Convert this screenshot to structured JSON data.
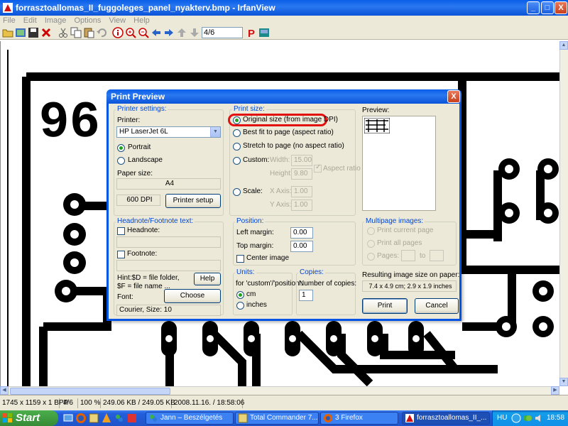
{
  "window": {
    "title": "forrasztoallomas_II_fuggoleges_panel_nyakterv.bmp - IrfanView",
    "minimize": "_",
    "maximize": "□",
    "close": "X"
  },
  "menu": [
    "File",
    "Edit",
    "Image",
    "Options",
    "View",
    "Help"
  ],
  "toolbar": {
    "page_counter": "4/6",
    "icons": [
      "open-folder",
      "thumbnails",
      "save",
      "delete",
      "cut",
      "copy",
      "paste",
      "undo",
      "info",
      "zoom-in",
      "zoom-out",
      "prev",
      "next",
      "first",
      "last",
      "page-field",
      "print-p",
      "paint"
    ]
  },
  "pcb_text": "96",
  "dialog": {
    "title": "Print Preview",
    "close": "X",
    "printer_settings": {
      "group": "Printer settings:",
      "printer_label": "Printer:",
      "printer_value": "HP LaserJet 6L",
      "portrait": "Portrait",
      "landscape": "Landscape",
      "paper_label": "Paper size:",
      "paper_value": "A4",
      "dpi": "600 DPI",
      "setup_button": "Printer setup"
    },
    "print_size": {
      "group": "Print size:",
      "original": "Original size (from image DPI)",
      "best_fit": "Best fit to page (aspect ratio)",
      "stretch": "Stretch to page (no aspect ratio)",
      "custom": "Custom:",
      "width_label": "Width:",
      "width_value": "15.00",
      "height_label": "Height:",
      "height_value": "9.80",
      "aspect": "Aspect ratio",
      "scale": "Scale:",
      "x_label": "X Axis:",
      "x_value": "1.00",
      "y_label": "Y Axis:",
      "y_value": "1.00"
    },
    "preview_label": "Preview:",
    "header_footer": {
      "group": "Headnote/Footnote text:",
      "headnote": "Headnote:",
      "footnote": "Footnote:",
      "hint1": "Hint:$D = file folder,",
      "hint2": "$F = file name ...",
      "help_button": "Help",
      "font_label": "Font:",
      "choose_button": "Choose",
      "font_value": "Courier, Size: 10"
    },
    "position": {
      "group": "Position:",
      "left_label": "Left margin:",
      "left_value": "0.00",
      "top_label": "Top margin:",
      "top_value": "0.00",
      "center": "Center image"
    },
    "units": {
      "group": "Units:",
      "hint": "for 'custom'/'position':",
      "cm": "cm",
      "inches": "inches"
    },
    "copies": {
      "group": "Copies:",
      "label": "Number of copies:",
      "value": "1"
    },
    "multipage": {
      "group": "Multipage images:",
      "current": "Print current page",
      "all": "Print all pages",
      "pages": "Pages:",
      "to": "to"
    },
    "result": {
      "label": "Resulting image size on paper:",
      "value": "7.4 x 4.9 cm; 2.9 x 1.9 inches"
    },
    "print_button": "Print",
    "cancel_button": "Cancel"
  },
  "status": {
    "dimensions": "1745 x 1159 x 1 BPP",
    "page": "4/6",
    "zoom": "100 %",
    "size": "249.06 KB / 249.05 KB",
    "datetime": "2008.11.16. / 18:58:06"
  },
  "taskbar": {
    "start": "Start",
    "tasks": [
      "Jann – Beszélgetés",
      "Total Commander 7....",
      "3 Firefox",
      "forrasztoallomas_II_..."
    ],
    "lang": "HU",
    "time": "18:58"
  },
  "colors": {
    "xp_blue": "#0a5ee8",
    "dialog_face": "#ece9d8",
    "highlight_red": "#e31010",
    "start_green": "#368b36",
    "radio_green": "#21a121"
  }
}
